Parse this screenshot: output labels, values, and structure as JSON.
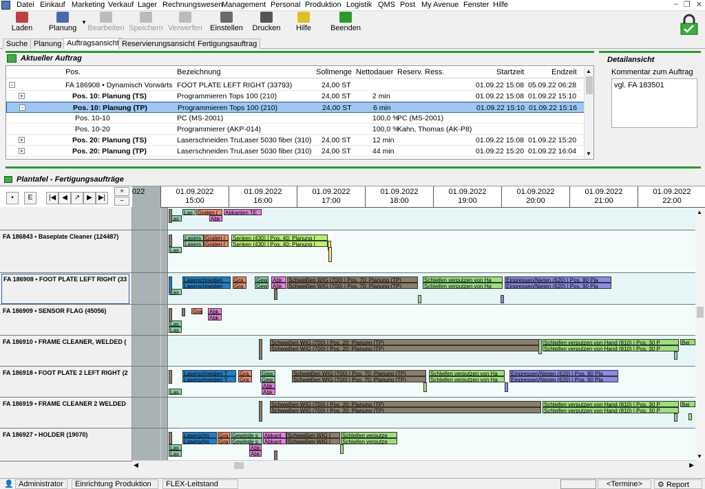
{
  "menu": [
    "Datei",
    "Einkauf",
    "Marketing",
    "Verkauf",
    "Lager",
    "Rechnungswesen",
    "Management",
    "Personal",
    "Produktion",
    "Logistik",
    "QMS",
    "Post",
    "My Avenue",
    "Fenster",
    "Hilfe"
  ],
  "toolbar": [
    {
      "label": "Laden",
      "icon": "load-icon",
      "disabled": false
    },
    {
      "label": "Planung",
      "icon": "planning-icon",
      "disabled": false
    },
    {
      "label": "Bearbeiten",
      "icon": "edit-icon",
      "disabled": true
    },
    {
      "label": "Speichern",
      "icon": "save-icon",
      "disabled": true
    },
    {
      "label": "Verwerfen",
      "icon": "discard-icon",
      "disabled": true
    },
    {
      "label": "Einstellen",
      "icon": "settings-icon",
      "disabled": false
    },
    {
      "label": "Drucken",
      "icon": "print-icon",
      "disabled": false
    },
    {
      "label": "Hilfe",
      "icon": "help-icon",
      "disabled": false
    },
    {
      "label": "Beenden",
      "icon": "exit-icon",
      "disabled": false
    }
  ],
  "tabs": [
    "Suche",
    "Planung",
    "Auftragsansicht",
    "Reservierungsansicht",
    "Fertigungsauftrag"
  ],
  "active_tab": "Auftragsansicht",
  "current_order": {
    "title": "Aktueller Auftrag",
    "columns": [
      "Pos.",
      "Bezeichnung",
      "Sollmenge",
      "Nettodauer",
      "Reserv. Ress.",
      "Startzeit",
      "Endzeit"
    ],
    "rows": [
      {
        "pos": "FA 186908 • Dynamisch Vorwärts",
        "bez": "FOOT PLATE LEFT RIGHT (33793)",
        "soll": "24,00 ST",
        "netto": "",
        "res": "",
        "start": "01.09.22 15:08",
        "end": "05.09.22 06:28",
        "bold": false,
        "toggle": "-",
        "indent": 0
      },
      {
        "pos": "Pos. 10: Planung (TS)",
        "bez": "Programmieren Tops 100 (210)",
        "soll": "24,00 ST",
        "netto": "2 min",
        "res": "",
        "start": "01.09.22 15:08",
        "end": "01.09.22 15:10",
        "bold": true,
        "toggle": "+",
        "indent": 1
      },
      {
        "pos": "Pos. 10: Planung (TP)",
        "bez": "Programmieren Tops 100 (210)",
        "soll": "24,00 ST",
        "netto": "6 min",
        "res": "",
        "start": "01.09.22 15:10",
        "end": "01.09.22 15:16",
        "bold": true,
        "toggle": "-",
        "indent": 1,
        "selected": true
      },
      {
        "pos": "Pos. 10-10",
        "bez": "PC (MS-2001)",
        "soll": "",
        "netto": "100,0 %",
        "res": "PC (MS-2001)",
        "start": "",
        "end": "",
        "bold": false,
        "toggle": "",
        "indent": 2
      },
      {
        "pos": "Pos. 10-20",
        "bez": "Programmierer (AKP-014)",
        "soll": "",
        "netto": "100,0 %",
        "res": "Kahn, Thomas (AK-P8)",
        "start": "",
        "end": "",
        "bold": false,
        "toggle": "",
        "indent": 2
      },
      {
        "pos": "Pos. 20: Planung (TS)",
        "bez": "Laserschneiden TruLaser 5030 fiber (310)",
        "soll": "24,00 ST",
        "netto": "12 min",
        "res": "",
        "start": "01.09.22 15:08",
        "end": "01.09.22 15:20",
        "bold": true,
        "toggle": "+",
        "indent": 1
      },
      {
        "pos": "Pos. 20: Planung (TP)",
        "bez": "Laserschneiden TruLaser 5030 fiber (310)",
        "soll": "24,00 ST",
        "netto": "44 min",
        "res": "",
        "start": "01.09.22 15:20",
        "end": "01.09.22 16:04",
        "bold": true,
        "toggle": "+",
        "indent": 1
      }
    ]
  },
  "detail": {
    "title": "Detailansicht",
    "comment_label": "Kommentar zum Auftrag",
    "comment": "vgl. FA 183501"
  },
  "plantafel": {
    "title": "Plantafel - Fertigungsaufträge",
    "nav": [
      "•",
      "E",
      "|◀",
      "◀",
      "↗",
      "▶",
      "▶|"
    ],
    "zoom_in": "+",
    "zoom_out": "−",
    "prev_col_label": "022",
    "times": [
      {
        "date": "01.09.2022",
        "time": "15:00"
      },
      {
        "date": "01.09.2022",
        "time": "16:00"
      },
      {
        "date": "01.09.2022",
        "time": "17:00"
      },
      {
        "date": "01.09.2022",
        "time": "18:00"
      },
      {
        "date": "01.09.2022",
        "time": "19:00"
      },
      {
        "date": "01.09.2022",
        "time": "20:00"
      },
      {
        "date": "01.09.2022",
        "time": "21:00"
      },
      {
        "date": "01.09.2022",
        "time": "22:00"
      }
    ],
    "lanes": [
      {
        "label": ""
      },
      {
        "label": "FA 186843 • Baseplate Cleaner (124487)"
      },
      {
        "label": "FA 186908 • FOOT PLATE LEFT RIGHT (33",
        "selected": true
      },
      {
        "label": "FA 186909 • SENSOR FLAG (45056)"
      },
      {
        "label": "FA 186910 • FRAME CLEANER, WELDED ("
      },
      {
        "label": "FA 186918 • FOOT PLATE 2 LEFT RIGHT (2"
      },
      {
        "label": "FA 186919 • FRAME CLEANER 2 WELDED"
      },
      {
        "label": "FA 186927 • HOLDER (19070)"
      }
    ],
    "bar_texts": {
      "las": "Las",
      "lasers": "Lasers",
      "graten": "Graten (",
      "abkanten": "Abkanten TE",
      "abk": "Abk",
      "gra": "Gra",
      "gew": "Gew",
      "senken": "Senken (430) | Pos. 40: Planung (",
      "laserschneiden": "Laserschneiden",
      "laserschneiden_t": "Laserschneiden T",
      "schweissen": "Schweißen WIG (700) | Pos. 70: Planung (TP)",
      "schweissen20": "Schweißen WIG (700) | Pos. 20: Planung (TP)",
      "schleifen": "Schleifen verputzen von Ha",
      "einpressen": "Einpressen/Nieten (620) | Pos. 90 Pla",
      "schleifen810": "Schleifen verputzen von Hand (810) | Pos. 30 P",
      "bei": "Bei",
      "laserschn": "Laserschn",
      "gewinde": "Gewinde s",
      "abkant": "Abkant",
      "schweissenwig": "Schweißen WIG (",
      "schleifenv": "Schleifen verputze"
    }
  },
  "status": {
    "user": "Administrator",
    "mode": "Einrichtung Produktion",
    "module": "FLEX-Leitstand",
    "termine": "<Termine>",
    "report": "Report"
  },
  "colors": {
    "green": "#2a9a2a",
    "laser": "#1e7fc8",
    "grat": "#e98a6a",
    "abk": "#e880e0",
    "weld": "#8a7e6a",
    "grind": "#9ae07a",
    "press": "#8a8ae8",
    "gew": "#8ad0a0",
    "senken": "#b6f26a",
    "yellow": "#f2e27a"
  }
}
